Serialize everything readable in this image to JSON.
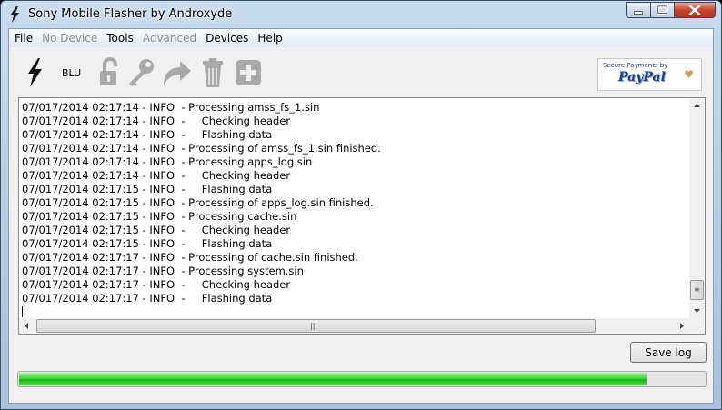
{
  "window": {
    "title": "Sony Mobile Flasher by Androxyde"
  },
  "menu": [
    {
      "label": "File",
      "enabled": true
    },
    {
      "label": "No Device",
      "enabled": false
    },
    {
      "label": "Tools",
      "enabled": true
    },
    {
      "label": "Advanced",
      "enabled": false
    },
    {
      "label": "Devices",
      "enabled": true
    },
    {
      "label": "Help",
      "enabled": true
    }
  ],
  "toolbar": {
    "blu_label": "BLU",
    "icons": [
      "flash-icon",
      "unlock-icon",
      "key-icon",
      "redo-arrow-icon",
      "trash-icon",
      "add-icon"
    ],
    "paypal": {
      "caption": "Secure Payments by",
      "logo": "PayPal"
    }
  },
  "log": {
    "lines": [
      "07/017/2014 02:17:14 - INFO  - Processing amss_fs_1.sin",
      "07/017/2014 02:17:14 - INFO  -     Checking header",
      "07/017/2014 02:17:14 - INFO  -     Flashing data",
      "07/017/2014 02:17:14 - INFO  - Processing of amss_fs_1.sin finished.",
      "07/017/2014 02:17:14 - INFO  - Processing apps_log.sin",
      "07/017/2014 02:17:14 - INFO  -     Checking header",
      "07/017/2014 02:17:15 - INFO  -     Flashing data",
      "07/017/2014 02:17:15 - INFO  - Processing of apps_log.sin finished.",
      "07/017/2014 02:17:15 - INFO  - Processing cache.sin",
      "07/017/2014 02:17:15 - INFO  -     Checking header",
      "07/017/2014 02:17:15 - INFO  -     Flashing data",
      "07/017/2014 02:17:17 - INFO  - Processing of cache.sin finished.",
      "07/017/2014 02:17:17 - INFO  - Processing system.sin",
      "07/017/2014 02:17:17 - INFO  -     Checking header",
      "07/017/2014 02:17:17 - INFO  -     Flashing data"
    ]
  },
  "actions": {
    "save_log_label": "Save log"
  },
  "progress": {
    "fraction": 0.915,
    "color": "#22c122"
  }
}
